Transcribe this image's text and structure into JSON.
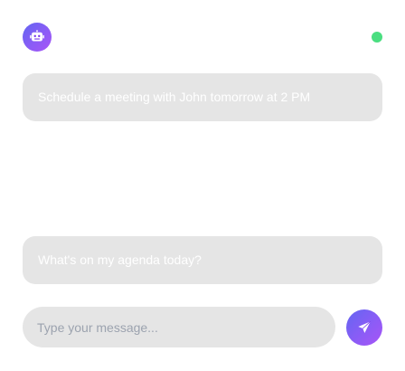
{
  "header": {
    "avatar_icon": "robot-icon",
    "status_color": "#4ade80"
  },
  "messages": [
    {
      "text": "Schedule a meeting with John tomorrow at 2 PM"
    },
    {
      "text": "What's on my agenda today?"
    }
  ],
  "composer": {
    "placeholder": "Type your message...",
    "value": "",
    "send_icon": "send-icon"
  },
  "colors": {
    "accent_start": "#6366f1",
    "accent_end": "#a855f7",
    "bubble_bg": "#e5e5e5"
  }
}
